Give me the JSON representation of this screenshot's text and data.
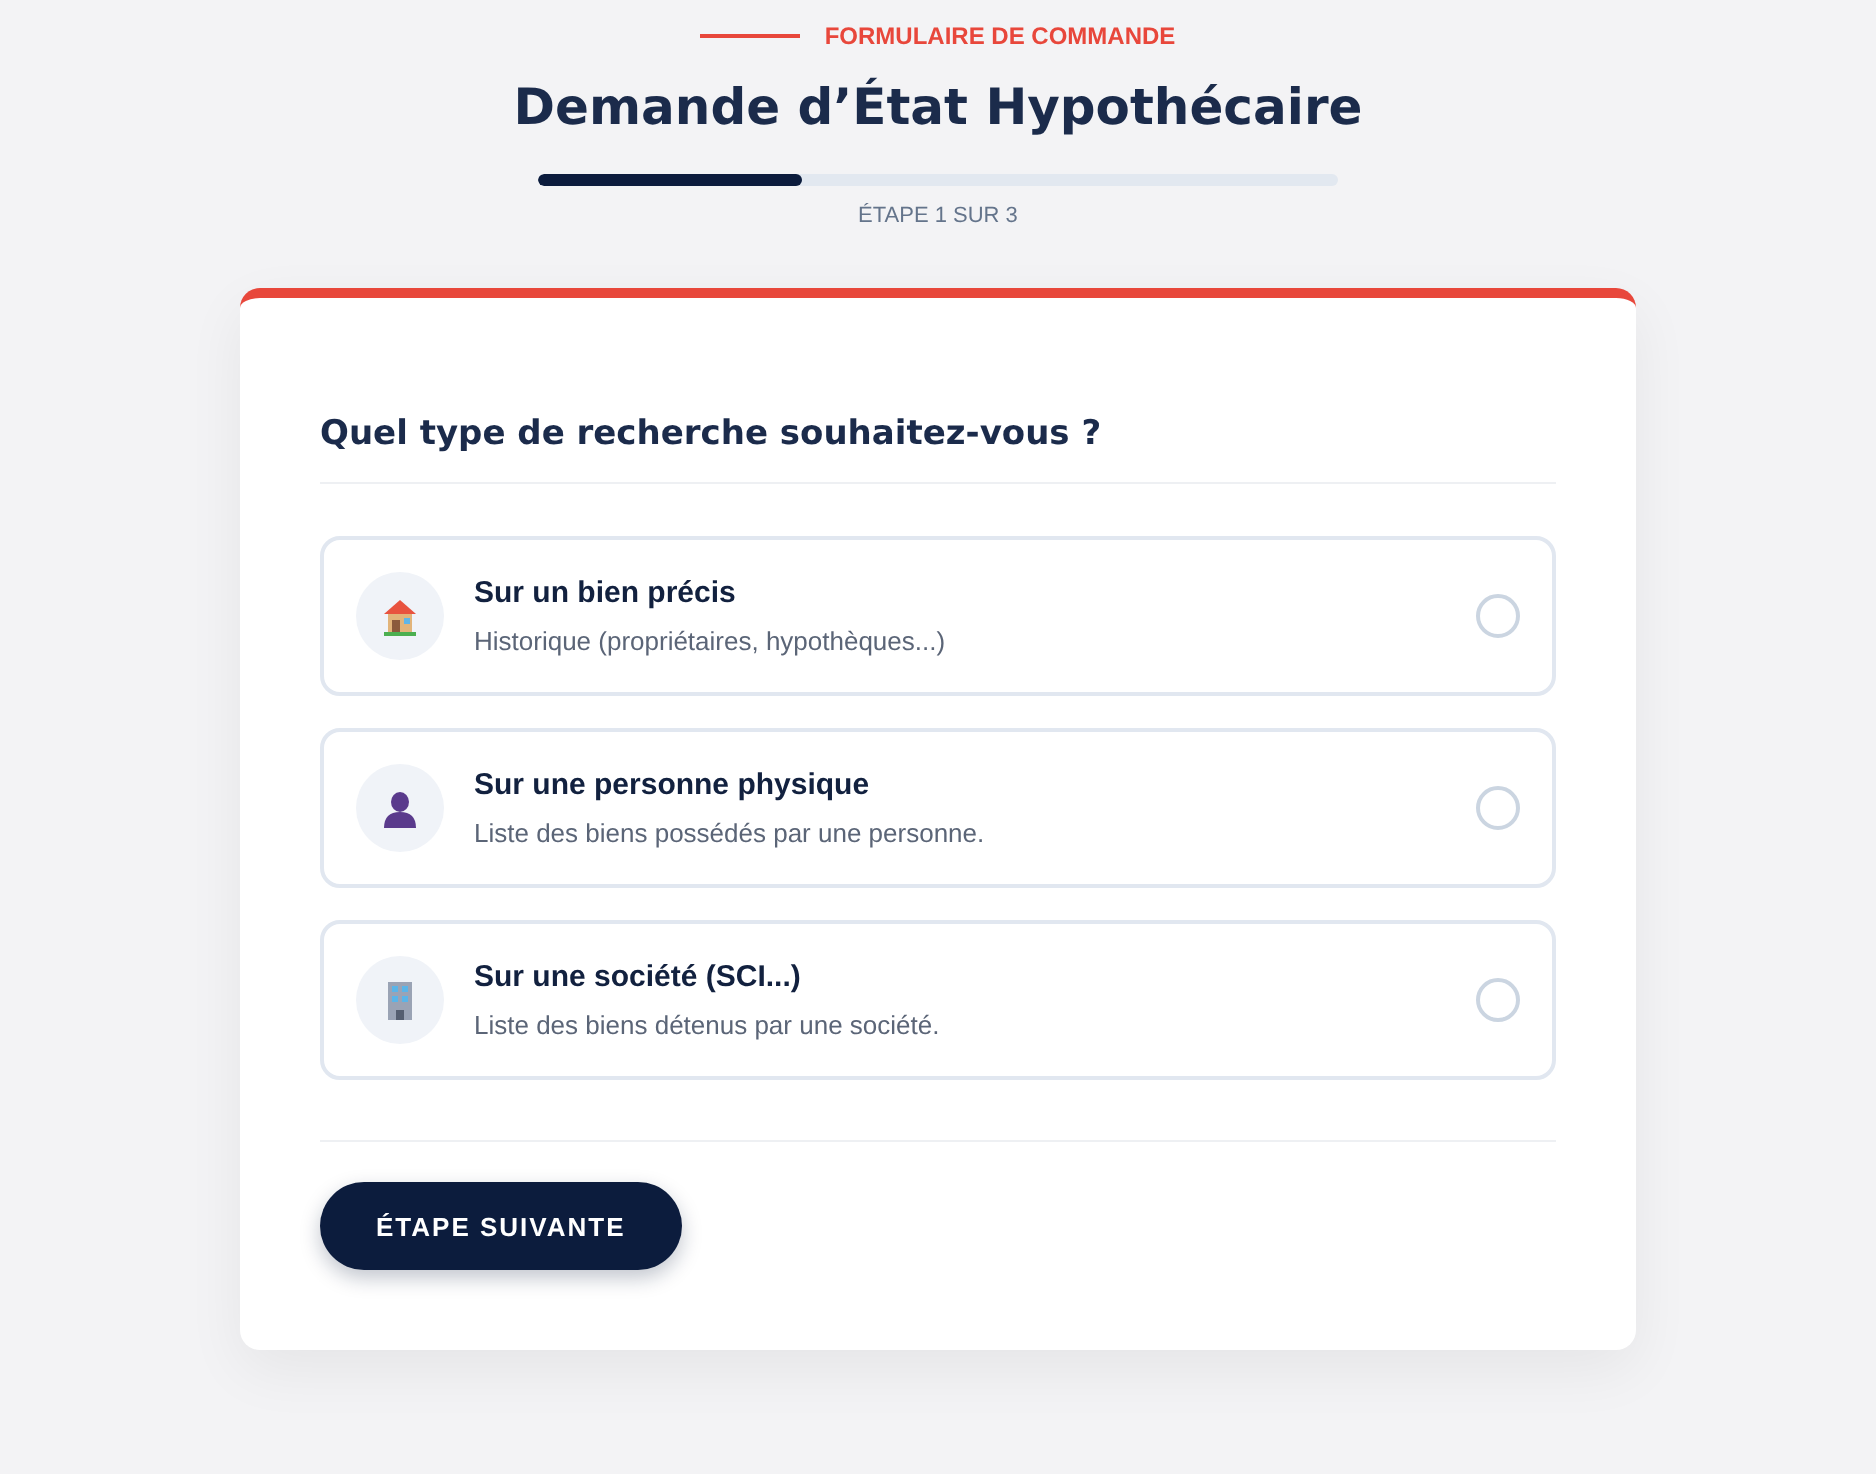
{
  "header": {
    "eyebrow": "FORMULAIRE DE COMMANDE",
    "title": "Demande d’État Hypothécaire",
    "progress": {
      "level": 0.33,
      "label": "ÉTAPE 1 SUR 3"
    }
  },
  "form": {
    "question": "Quel type de recherche souhaitez-vous ?",
    "options": [
      {
        "kind": "house",
        "title": "Sur un bien précis",
        "description": "Historique (propriétaires, hypothèques...)",
        "selected": false
      },
      {
        "kind": "person",
        "title": "Sur une personne physique",
        "description": "Liste des biens possédés par une personne.",
        "selected": false
      },
      {
        "kind": "building",
        "title": "Sur une société (SCI...)",
        "description": "Liste des biens détenus par une société.",
        "selected": false
      }
    ],
    "next_button": "ÉTAPE SUIVANTE"
  }
}
